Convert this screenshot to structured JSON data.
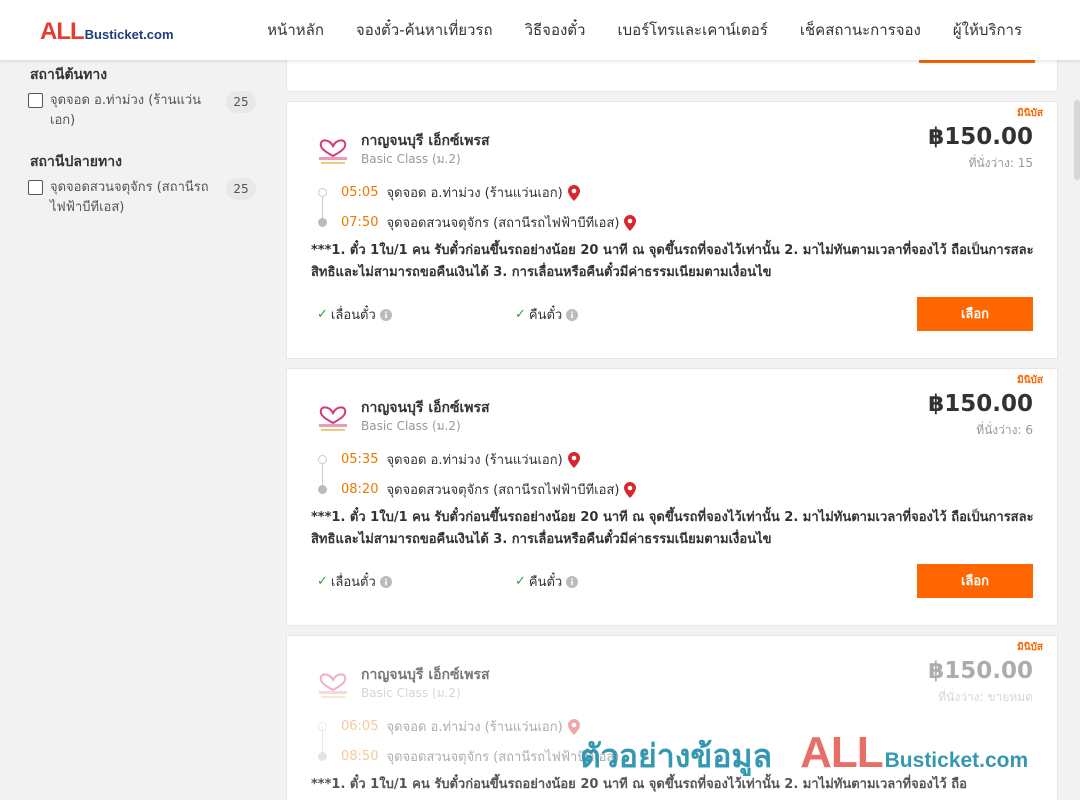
{
  "brand": {
    "logo_part1": "ALL",
    "logo_part2": "Busticket.com",
    "accent": "#ff6600",
    "logo_red": "#e63b2e",
    "logo_blue": "#1c3f7a"
  },
  "nav": [
    "หน้าหลัก",
    "จองตั๋ว-ค้นหาเที่ยวรถ",
    "วิธีจองตั๋ว",
    "เบอร์โทรและเคาน์เตอร์",
    "เช็คสถานะการจอง",
    "ผู้ให้บริการ"
  ],
  "filters": {
    "origin": {
      "title": "สถานีต้นทาง",
      "item": {
        "label": "จุดจอด อ.ท่าม่วง (ร้านแว่นเอก)",
        "count": "25"
      }
    },
    "destination": {
      "title": "สถานีปลายทาง",
      "item": {
        "label": "จุดจอดสวนจตุจักร (สถานีรถไฟฟ้าบีทีเอส)",
        "count": "25"
      }
    }
  },
  "trips": [
    {
      "bus_type": "มินิบัส",
      "operator": "กาญจนบุรี เอ็กซ์เพรส",
      "class": "Basic Class (ม.2)",
      "price": "฿150.00",
      "seats": "ที่นั่งว่าง: 15",
      "dep_time": "05:05",
      "dep_stop": "จุดจอด อ.ท่าม่วง (ร้านแว่นเอก)",
      "arr_time": "07:50",
      "arr_stop": "จุดจอดสวนจตุจักร (สถานีรถไฟฟ้าบีทีเอส)",
      "notice": "***1. ตั๋ว 1ใบ/1 คน รับตั๋วก่อนขึ้นรถอย่างน้อย 20 นาที ณ จุดขึ้นรถที่จองไว้เท่านั้น 2. มาไม่ทันตามเวลาที่จองไว้ ถือเป็นการสละสิทธิและไม่สามารถขอคืนเงินได้ 3. การเลื่อนหรือคืนตั๋วมีค่าธรรมเนียมตามเงื่อนไข",
      "feature1": "เลื่อนตั๋ว",
      "feature2": "คืนตั๋ว",
      "select": "เลือก"
    },
    {
      "bus_type": "มินิบัส",
      "operator": "กาญจนบุรี เอ็กซ์เพรส",
      "class": "Basic Class (ม.2)",
      "price": "฿150.00",
      "seats": "ที่นั่งว่าง: 6",
      "dep_time": "05:35",
      "dep_stop": "จุดจอด อ.ท่าม่วง (ร้านแว่นเอก)",
      "arr_time": "08:20",
      "arr_stop": "จุดจอดสวนจตุจักร (สถานีรถไฟฟ้าบีทีเอส)",
      "notice": "***1. ตั๋ว 1ใบ/1 คน รับตั๋วก่อนขึ้นรถอย่างน้อย 20 นาที ณ จุดขึ้นรถที่จองไว้เท่านั้น 2. มาไม่ทันตามเวลาที่จองไว้ ถือเป็นการสละสิทธิและไม่สามารถขอคืนเงินได้ 3. การเลื่อนหรือคืนตั๋วมีค่าธรรมเนียมตามเงื่อนไข",
      "feature1": "เลื่อนตั๋ว",
      "feature2": "คืนตั๋ว",
      "select": "เลือก"
    },
    {
      "bus_type": "มินิบัส",
      "operator": "กาญจนบุรี เอ็กซ์เพรส",
      "class": "Basic Class (ม.2)",
      "price": "฿150.00",
      "seats": "ที่นั่งว่าง: ขายหมด",
      "dep_time": "06:05",
      "dep_stop": "จุดจอด อ.ท่าม่วง (ร้านแว่นเอก)",
      "arr_time": "08:50",
      "arr_stop": "จุดจอดสวนจตุจักร (สถานีรถไฟฟ้าบีทีเอส)",
      "notice": "***1. ตั๋ว 1ใบ/1 คน รับตั๋วก่อนขึ้นรถอย่างน้อย 20 นาที ณ จุดขึ้นรถที่จองไว้เท่านั้น 2. มาไม่ทันตามเวลาที่จองไว้ ถือ"
    }
  ],
  "watermark": {
    "thai": "ตัวอย่างข้อมูล",
    "all": "ALL",
    "rest": "Busticket.com"
  }
}
